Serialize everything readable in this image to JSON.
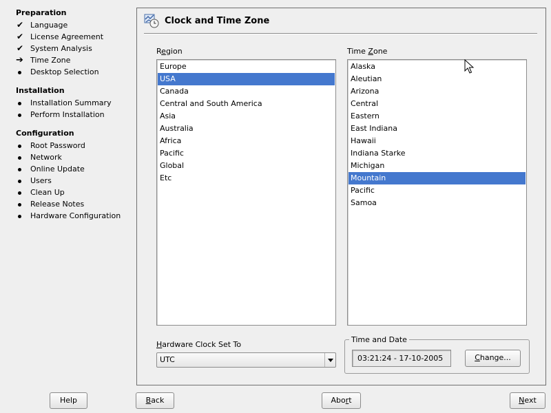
{
  "sidebar": {
    "sections": [
      {
        "title": "Preparation",
        "items": [
          {
            "label": "Language",
            "state": "done"
          },
          {
            "label": "License Agreement",
            "state": "done"
          },
          {
            "label": "System Analysis",
            "state": "done"
          },
          {
            "label": "Time Zone",
            "state": "current"
          },
          {
            "label": "Desktop Selection",
            "state": "pending"
          }
        ]
      },
      {
        "title": "Installation",
        "items": [
          {
            "label": "Installation Summary",
            "state": "pending"
          },
          {
            "label": "Perform Installation",
            "state": "pending"
          }
        ]
      },
      {
        "title": "Configuration",
        "items": [
          {
            "label": "Root Password",
            "state": "pending"
          },
          {
            "label": "Network",
            "state": "pending"
          },
          {
            "label": "Online Update",
            "state": "pending"
          },
          {
            "label": "Users",
            "state": "pending"
          },
          {
            "label": "Clean Up",
            "state": "pending"
          },
          {
            "label": "Release Notes",
            "state": "pending"
          },
          {
            "label": "Hardware Configuration",
            "state": "pending"
          }
        ]
      }
    ]
  },
  "main": {
    "title": "Clock and Time Zone",
    "region": {
      "label_pre": "R",
      "label_ul": "e",
      "label_post": "gion",
      "items": [
        "Europe",
        "USA",
        "Canada",
        "Central and South America",
        "Asia",
        "Australia",
        "Africa",
        "Pacific",
        "Global",
        "Etc"
      ],
      "selected": 1
    },
    "timezone": {
      "label_pre": "Time ",
      "label_ul": "Z",
      "label_post": "one",
      "items": [
        "Alaska",
        "Aleutian",
        "Arizona",
        "Central",
        "Eastern",
        "East Indiana",
        "Hawaii",
        "Indiana Starke",
        "Michigan",
        "Mountain",
        "Pacific",
        "Samoa"
      ],
      "selected": 9
    },
    "hwclock": {
      "label_pre": "",
      "label_ul": "H",
      "label_post": "ardware Clock Set To",
      "value": "UTC"
    },
    "time_and_date": {
      "legend": "Time and Date",
      "value": "03:21:24 - 17-10-2005",
      "change_pre": "",
      "change_ul": "C",
      "change_post": "hange..."
    }
  },
  "buttons": {
    "help": "Help",
    "back_pre": "",
    "back_ul": "B",
    "back_post": "ack",
    "abort_pre": "Abo",
    "abort_ul": "r",
    "abort_post": "t",
    "next_pre": "",
    "next_ul": "N",
    "next_post": "ext"
  },
  "colors": {
    "selection": "#4478ce",
    "background": "#efefef"
  }
}
